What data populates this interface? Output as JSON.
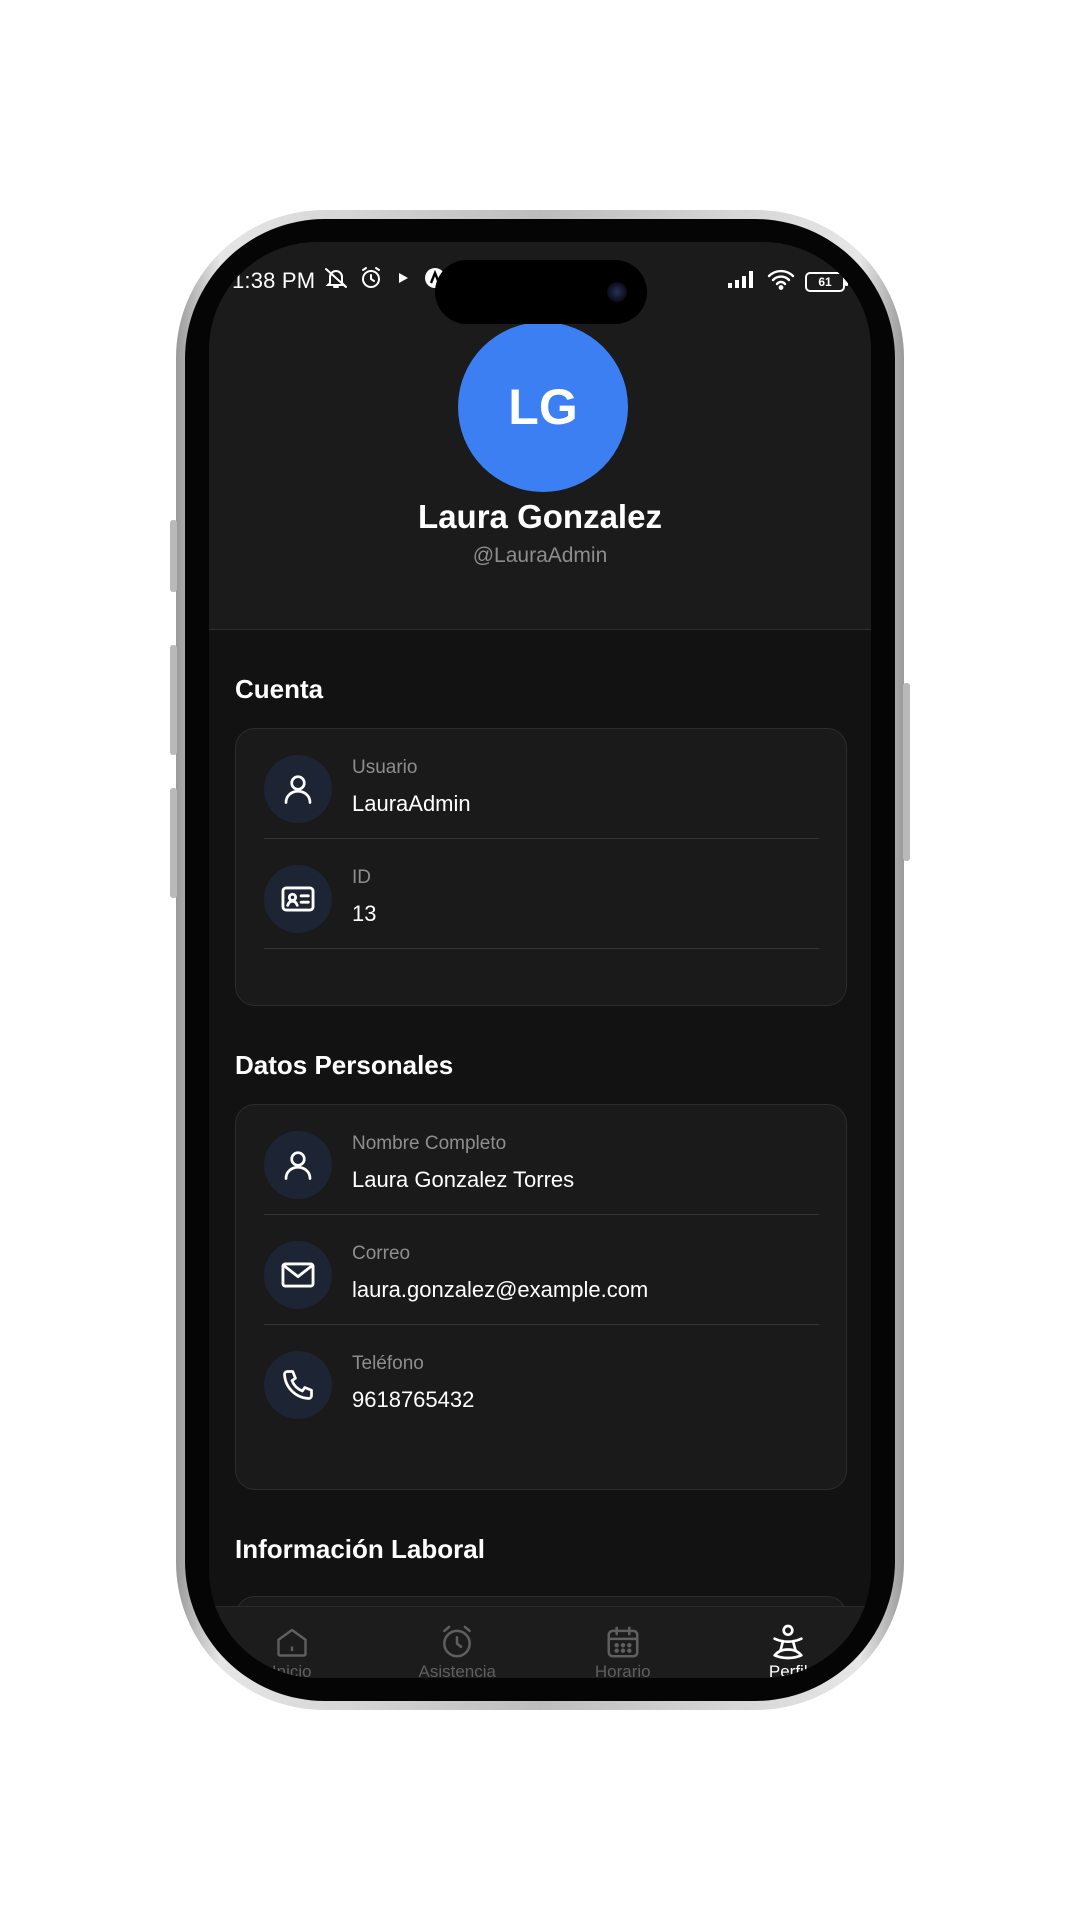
{
  "status_bar": {
    "time": "1:38 PM",
    "battery": "61"
  },
  "profile": {
    "initials": "LG",
    "name": "Laura Gonzalez",
    "handle": "@LauraAdmin",
    "avatar_color": "#3b7ff2"
  },
  "sections": {
    "account": {
      "title": "Cuenta",
      "rows": [
        {
          "label": "Usuario",
          "value": "LauraAdmin",
          "icon": "user-icon"
        },
        {
          "label": "ID",
          "value": "13",
          "icon": "id-card-icon"
        }
      ]
    },
    "personal": {
      "title": "Datos Personales",
      "rows": [
        {
          "label": "Nombre Completo",
          "value": "Laura Gonzalez Torres",
          "icon": "user-icon"
        },
        {
          "label": "Correo",
          "value": "laura.gonzalez@example.com",
          "icon": "mail-icon"
        },
        {
          "label": "Teléfono",
          "value": "9618765432",
          "icon": "phone-icon"
        }
      ]
    },
    "work": {
      "title": "Información Laboral"
    }
  },
  "nav": {
    "items": [
      {
        "label": "Inicio",
        "icon": "home-icon"
      },
      {
        "label": "Asistencia",
        "icon": "alarm-clock-icon"
      },
      {
        "label": "Horario",
        "icon": "calendar-icon"
      },
      {
        "label": "Perfil",
        "icon": "profile-icon",
        "active": true
      }
    ]
  }
}
